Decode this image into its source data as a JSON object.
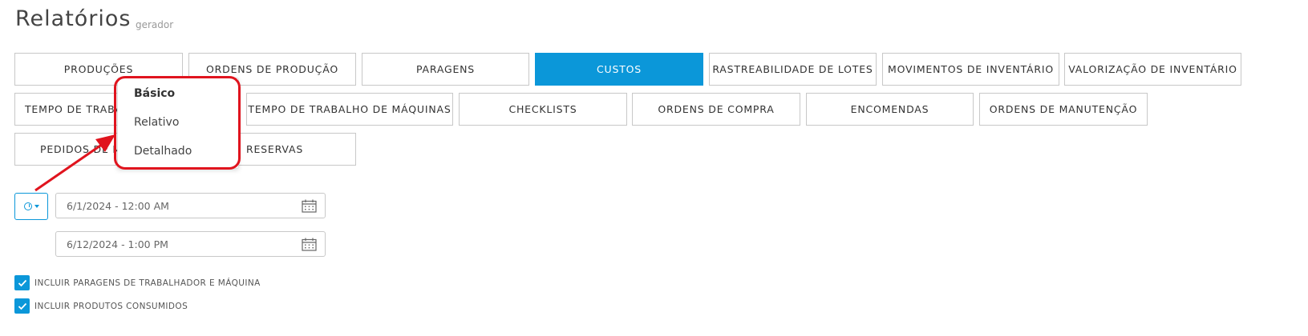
{
  "header": {
    "title": "Relatórios",
    "subtitle": "gerador"
  },
  "tabs": [
    {
      "label": "PRODUÇÕES"
    },
    {
      "label": "ORDENS DE PRODUÇÃO"
    },
    {
      "label": "PARAGENS"
    },
    {
      "label": "CUSTOS",
      "active": true
    },
    {
      "label": "RASTREABILIDADE DE LOTES"
    },
    {
      "label": "MOVIMENTOS DE INVENTÁRIO"
    },
    {
      "label": "VALORIZAÇÃO DE INVENTÁRIO"
    },
    {
      "label": "TEMPO DE TRABA"
    },
    {
      "label": "TEMPO DE TRABALHO DE MÁQUINAS"
    },
    {
      "label": "CHECKLISTS"
    },
    {
      "label": "ORDENS DE COMPRA"
    },
    {
      "label": "ENCOMENDAS"
    },
    {
      "label": "ORDENS DE MANUTENÇÃO"
    },
    {
      "label": "PEDIDOS DE M"
    },
    {
      "label": "RESERVAS"
    }
  ],
  "dropdown": {
    "items": [
      {
        "label": "Básico",
        "selected": true
      },
      {
        "label": "Relativo"
      },
      {
        "label": "Detalhado"
      }
    ]
  },
  "range_button": {
    "icon": "clock-icon"
  },
  "dates": {
    "start": "6/1/2024 - 12:00 AM",
    "end": "6/12/2024 - 1:00 PM"
  },
  "checkboxes": [
    {
      "label": "INCLUIR PARAGENS DE TRABALHADOR E MÁQUINA",
      "checked": true
    },
    {
      "label": "INCLUIR PRODUTOS CONSUMIDOS",
      "checked": true
    }
  ],
  "colors": {
    "accent": "#0b97d9",
    "annotation": "#e0141e"
  }
}
